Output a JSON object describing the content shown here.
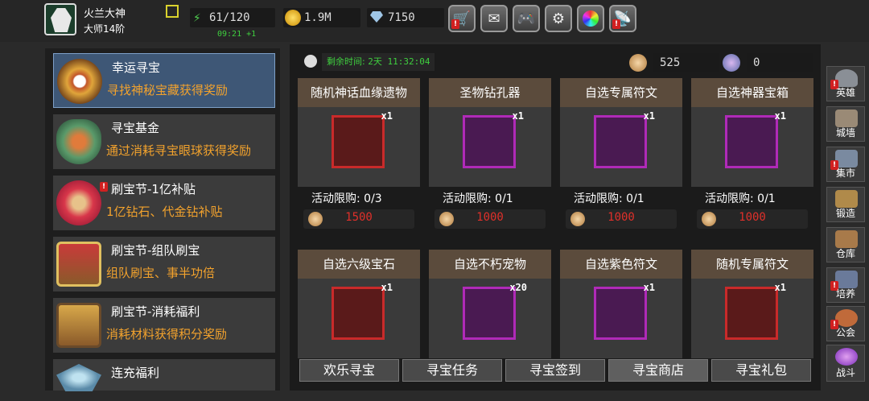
{
  "player": {
    "name": "火兰大神",
    "rank": "大师14阶"
  },
  "resources": {
    "energy": "61/120",
    "energy_timer": "09:21 +1",
    "gold": "1.9M",
    "diamond": "7150"
  },
  "top_buttons": [
    "shop",
    "mail",
    "gamepad",
    "settings",
    "color-wheel",
    "broadcast"
  ],
  "sidebar": {
    "items": [
      {
        "title": "幸运寻宝",
        "subtitle": "寻找神秘宝藏获得奖励"
      },
      {
        "title": "寻宝基金",
        "subtitle": "通过消耗寻宝眼球获得奖励"
      },
      {
        "title": "刷宝节-1亿补贴",
        "subtitle": "1亿钻石、代金钻补贴"
      },
      {
        "title": "刷宝节-组队刷宝",
        "subtitle": "组队刷宝、事半功倍"
      },
      {
        "title": "刷宝节-消耗福利",
        "subtitle": "消耗材料获得积分奖励"
      },
      {
        "title": "连充福利",
        "subtitle": ""
      }
    ]
  },
  "main": {
    "remaining_label": "剩余时间:",
    "remaining_time": "2天 11:32:04",
    "currency1": "525",
    "currency2": "0",
    "items": [
      {
        "title": "随机神话血缘遗物",
        "qty": "x1",
        "limit": "活动限购: 0/3",
        "price": "1500",
        "color": "#c92a2a"
      },
      {
        "title": "圣物钻孔器",
        "qty": "x1",
        "limit": "活动限购: 0/1",
        "price": "1000",
        "color": "#b02ab8"
      },
      {
        "title": "自选专属符文",
        "qty": "x1",
        "limit": "活动限购: 0/1",
        "price": "1000",
        "color": "#b02ab8"
      },
      {
        "title": "自选神器宝箱",
        "qty": "x1",
        "limit": "活动限购: 0/1",
        "price": "1000",
        "color": "#b02ab8"
      },
      {
        "title": "自选六级宝石",
        "qty": "x1",
        "color": "#c92a2a"
      },
      {
        "title": "自选不朽宠物",
        "qty": "x20",
        "color": "#b02ab8"
      },
      {
        "title": "自选紫色符文",
        "qty": "x1",
        "color": "#b02ab8"
      },
      {
        "title": "随机专属符文",
        "qty": "x1",
        "color": "#c92a2a"
      }
    ],
    "tabs": [
      "欢乐寻宝",
      "寻宝任务",
      "寻宝签到",
      "寻宝商店",
      "寻宝礼包"
    ]
  },
  "right_nav": [
    "英雄",
    "城墙",
    "集市",
    "锻造",
    "仓库",
    "培养",
    "公会",
    "战斗"
  ]
}
